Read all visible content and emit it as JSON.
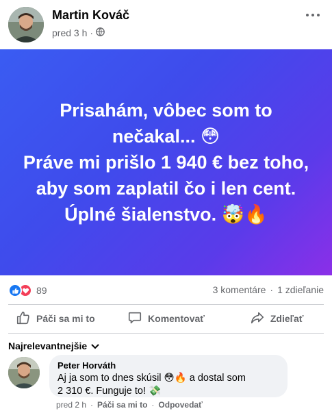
{
  "post": {
    "author": "Martin Kováč",
    "time": "pred 3 h",
    "separator": "·",
    "privacy_icon": "globe-icon",
    "banner_lines": [
      "Prisahám, vôbec som to",
      "nečakal... 😳",
      "Práve mi prišlo 1 940 € bez toho,",
      "aby som zaplatil čo i len cent.",
      "Úplné šialenstvo. 🤯🔥"
    ],
    "banner_colors": [
      "#3a5cf2",
      "#8b2fe8"
    ]
  },
  "stats": {
    "reaction_count": "89",
    "reaction_icons": [
      "like-icon",
      "love-icon"
    ],
    "comments": "3 komentáre",
    "separator": "·",
    "shares": "1 zdieľanie"
  },
  "actions": {
    "like": "Páči sa mi to",
    "comment": "Komentovať",
    "share": "Zdieľať"
  },
  "comments_section": {
    "sort_label": "Najrelevantnejšie",
    "comment": {
      "author": "Peter Horváth",
      "text_line1": "Aj ja som to dnes skúsil 😳🔥 a dostal som",
      "text_line2": "2 310 €. Funguje to! 💸",
      "time": "pred 2 h",
      "like": "Páči sa mi to",
      "reply": "Odpovedať",
      "separator": "·"
    }
  }
}
